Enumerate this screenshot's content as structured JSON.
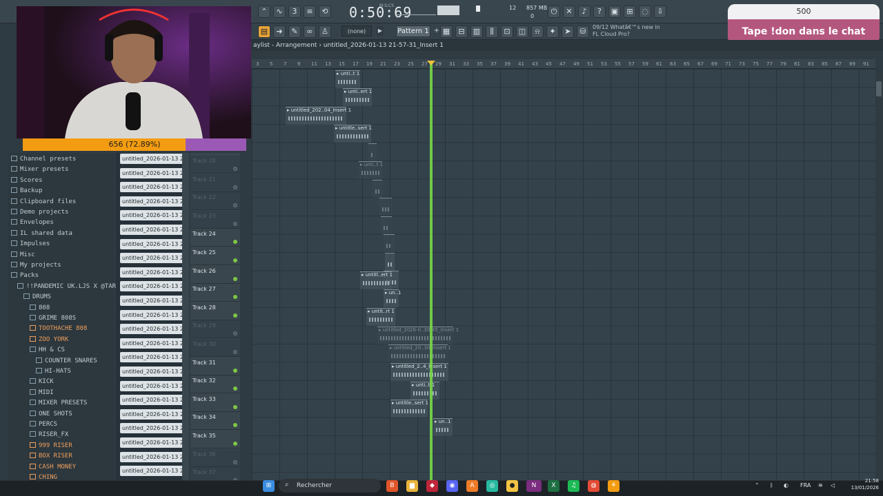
{
  "toolbar": {
    "song_time": "0:50:69",
    "time_unit": "M:S:CS",
    "cpu": "12",
    "memory": "857 MB",
    "memory_sub": "0",
    "snap": "(none)",
    "pattern": "Pattern 1",
    "news": "09/12  Whatâ€™s new in FL Cloud Pro?"
  },
  "donation": {
    "amount": "500",
    "message": "Tape !don dans le chat"
  },
  "webcam": {
    "progress_label": "656 (72.89%)",
    "progress_fraction": 0.7289
  },
  "playlist": {
    "title": "aylist - Arrangement",
    "breadcrumb": "untitled_2026-01-13 21-57-31_Insert 1",
    "ruler": [
      "3",
      "5",
      "7",
      "9",
      "11",
      "13",
      "15",
      "17",
      "19",
      "21",
      "23",
      "25",
      "27",
      "29",
      "31",
      "33",
      "35",
      "37",
      "39",
      "41",
      "43",
      "45",
      "47",
      "49",
      "51",
      "53",
      "55",
      "57",
      "59",
      "61",
      "63",
      "65",
      "67",
      "69",
      "71",
      "73",
      "75",
      "77",
      "79",
      "81",
      "83",
      "85",
      "87",
      "89",
      "91"
    ]
  },
  "browser": {
    "items": [
      {
        "label": "Channel presets",
        "indent": 0,
        "icon": "preset-icon",
        "color": "normal"
      },
      {
        "label": "Mixer presets",
        "indent": 0,
        "icon": "preset-icon",
        "color": "normal"
      },
      {
        "label": "Scores",
        "indent": 0,
        "icon": "score-icon",
        "color": "normal"
      },
      {
        "label": "Backup",
        "indent": 0,
        "icon": "folder-icon",
        "color": "normal"
      },
      {
        "label": "Clipboard files",
        "indent": 0,
        "icon": "folder-icon",
        "color": "normal"
      },
      {
        "label": "Demo projects",
        "indent": 0,
        "icon": "folder-icon",
        "color": "normal"
      },
      {
        "label": "Envelopes",
        "indent": 0,
        "icon": "folder-icon",
        "color": "normal"
      },
      {
        "label": "IL shared data",
        "indent": 0,
        "icon": "folder-icon",
        "color": "normal"
      },
      {
        "label": "Impulses",
        "indent": 0,
        "icon": "folder-icon",
        "color": "normal"
      },
      {
        "label": "Misc",
        "indent": 0,
        "icon": "folder-icon",
        "color": "normal"
      },
      {
        "label": "My projects",
        "indent": 0,
        "icon": "folder-icon",
        "color": "normal"
      },
      {
        "label": "Packs",
        "indent": 0,
        "icon": "folder-open-icon",
        "color": "normal"
      },
      {
        "label": "!!PANDEMIC UK.LJS X @TARGETT",
        "indent": 1,
        "icon": "folder-open-icon",
        "color": "normal"
      },
      {
        "label": "DRUMS",
        "indent": 2,
        "icon": "folder-open-icon",
        "color": "normal"
      },
      {
        "label": "808",
        "indent": 3,
        "icon": "folder-icon",
        "color": "normal"
      },
      {
        "label": "GRIME 808S",
        "indent": 3,
        "icon": "folder-icon",
        "color": "normal"
      },
      {
        "label": "TOOTHACHE 808",
        "indent": 3,
        "icon": "folder-icon",
        "color": "orange"
      },
      {
        "label": "ZOO YORK",
        "indent": 3,
        "icon": "folder-icon",
        "color": "orange"
      },
      {
        "label": "HH & CS",
        "indent": 3,
        "icon": "folder-open-icon",
        "color": "normal"
      },
      {
        "label": "COUNTER SNARES",
        "indent": 4,
        "icon": "folder-icon",
        "color": "normal"
      },
      {
        "label": "HI-HATS",
        "indent": 4,
        "icon": "folder-icon",
        "color": "normal"
      },
      {
        "label": "KICK",
        "indent": 3,
        "icon": "folder-icon",
        "color": "normal"
      },
      {
        "label": "MIDI",
        "indent": 3,
        "icon": "folder-icon",
        "color": "normal"
      },
      {
        "label": "MIXER PRESETS",
        "indent": 3,
        "icon": "folder-icon",
        "color": "normal"
      },
      {
        "label": "ONE SHOTS",
        "indent": 3,
        "icon": "folder-icon",
        "color": "normal"
      },
      {
        "label": "PERCS",
        "indent": 3,
        "icon": "folder-icon",
        "color": "normal"
      },
      {
        "label": "RISER_FX",
        "indent": 3,
        "icon": "folder-open-icon",
        "color": "normal"
      },
      {
        "label": "999 RISER",
        "indent": 3,
        "icon": "folder-icon",
        "color": "orange"
      },
      {
        "label": "BOX RISER",
        "indent": 3,
        "icon": "folder-icon",
        "color": "orange"
      },
      {
        "label": "CASH MONEY",
        "indent": 3,
        "icon": "folder-icon",
        "color": "orange"
      },
      {
        "label": "CHING",
        "indent": 3,
        "icon": "folder-icon",
        "color": "orange"
      }
    ]
  },
  "channels": {
    "label": "untitled_2026-01-13 21-...",
    "count": 23
  },
  "tracks": [
    {
      "name": "Track 20",
      "active": false
    },
    {
      "name": "Track 21",
      "active": false
    },
    {
      "name": "Track 22",
      "active": false
    },
    {
      "name": "Track 23",
      "active": false
    },
    {
      "name": "Track 24",
      "active": true
    },
    {
      "name": "Track 25",
      "active": true
    },
    {
      "name": "Track 26",
      "active": true
    },
    {
      "name": "Track 27",
      "active": true
    },
    {
      "name": "Track 28",
      "active": true
    },
    {
      "name": "Track 29",
      "active": false
    },
    {
      "name": "Track 30",
      "active": false
    },
    {
      "name": "Track 31",
      "active": true
    },
    {
      "name": "Track 32",
      "active": true
    },
    {
      "name": "Track 33",
      "active": true
    },
    {
      "name": "Track 34",
      "active": true
    },
    {
      "name": "Track 35",
      "active": true
    },
    {
      "name": "Track 36",
      "active": false
    },
    {
      "name": "Track 37",
      "active": false
    }
  ],
  "clips": [
    {
      "label": "unti..t 1",
      "faint": false
    },
    {
      "label": "unti..ert 1",
      "faint": false
    },
    {
      "label": "untitled_202..04_Insert 1",
      "faint": false
    },
    {
      "label": "untitle..sert 1",
      "faint": false
    },
    {
      "label": "",
      "faint": true
    },
    {
      "label": "unti..t 1",
      "faint": true
    },
    {
      "label": "",
      "faint": true
    },
    {
      "label": "",
      "faint": true
    },
    {
      "label": "",
      "faint": true
    },
    {
      "label": "",
      "faint": true
    },
    {
      "label": "",
      "faint": false
    },
    {
      "label": "",
      "faint": false
    },
    {
      "label": "untitl..ert 1",
      "faint": false
    },
    {
      "label": "un..1",
      "faint": false
    },
    {
      "label": "untit..rt 1",
      "faint": false
    },
    {
      "label": "untitled_2026-0..30-45_Insert 1",
      "faint": true
    },
    {
      "label": "untitled_20..30_Insert 1",
      "faint": true
    },
    {
      "label": "untitled_2..4_Insert 1",
      "faint": false
    },
    {
      "label": "unti..t 1",
      "faint": false
    },
    {
      "label": "untitle..sert 1",
      "faint": false
    },
    {
      "label": "un..1",
      "faint": false
    }
  ],
  "taskbar": {
    "search_placeholder": "Rechercher",
    "lang": "FRA",
    "time": "21:58",
    "date": "13/01/2026"
  },
  "colors": {
    "playhead": "#7be04a",
    "accent_orange": "#f39c12",
    "donation_pink": "#b4577f"
  }
}
